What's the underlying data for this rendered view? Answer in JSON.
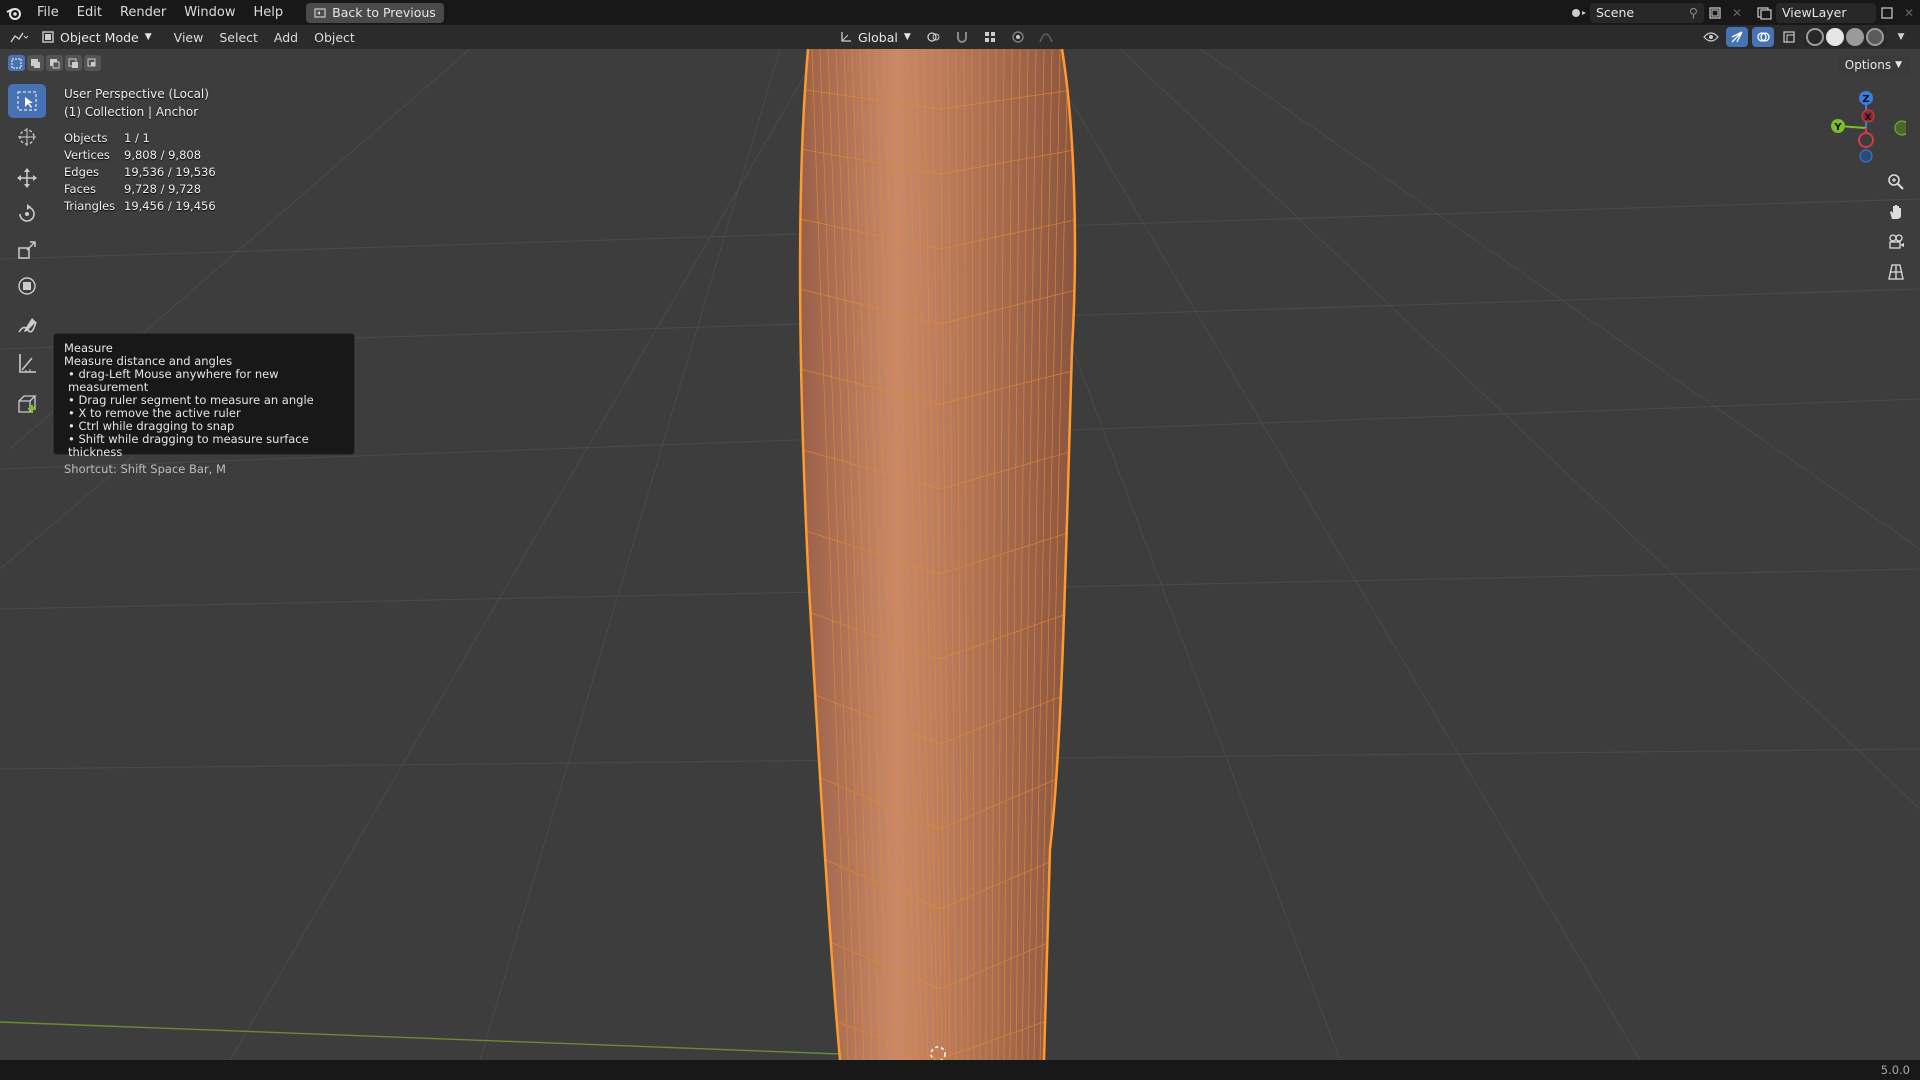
{
  "menubar": {
    "items": [
      "File",
      "Edit",
      "Render",
      "Window",
      "Help"
    ],
    "back_button": "Back to Previous",
    "scene": "Scene",
    "view_layer": "ViewLayer"
  },
  "header": {
    "mode": "Object Mode",
    "menus": [
      "View",
      "Select",
      "Add",
      "Object"
    ],
    "transform_orientation": "Global",
    "options_label": "Options"
  },
  "viewport": {
    "perspective": "User Perspective (Local)",
    "collection": "(1) Collection | Anchor"
  },
  "stats": [
    {
      "label": "Objects",
      "value": "1 / 1"
    },
    {
      "label": "Vertices",
      "value": "9,808 / 9,808"
    },
    {
      "label": "Edges",
      "value": "19,536 / 19,536"
    },
    {
      "label": "Faces",
      "value": "9,728 / 9,728"
    },
    {
      "label": "Triangles",
      "value": "19,456 / 19,456"
    }
  ],
  "tooltip": {
    "title": "Measure",
    "description": "Measure distance and angles",
    "bullets": [
      "drag-Left Mouse anywhere for new measurement",
      "Drag ruler segment to measure an angle",
      "X to remove the active ruler",
      "Ctrl while dragging to snap",
      "Shift while dragging to measure surface thickness"
    ],
    "shortcut": "Shortcut: Shift Space Bar, M"
  },
  "gizmo": {
    "x": "X",
    "y": "Y",
    "z": "Z"
  },
  "colors": {
    "accent": "#4772b3",
    "mesh": "#b8785a",
    "wire": "#ff9a2e",
    "axis_x": "#d63a48",
    "axis_y": "#7fbd2a",
    "axis_z": "#3b7de0"
  },
  "status": {
    "version": "5.0.0"
  }
}
